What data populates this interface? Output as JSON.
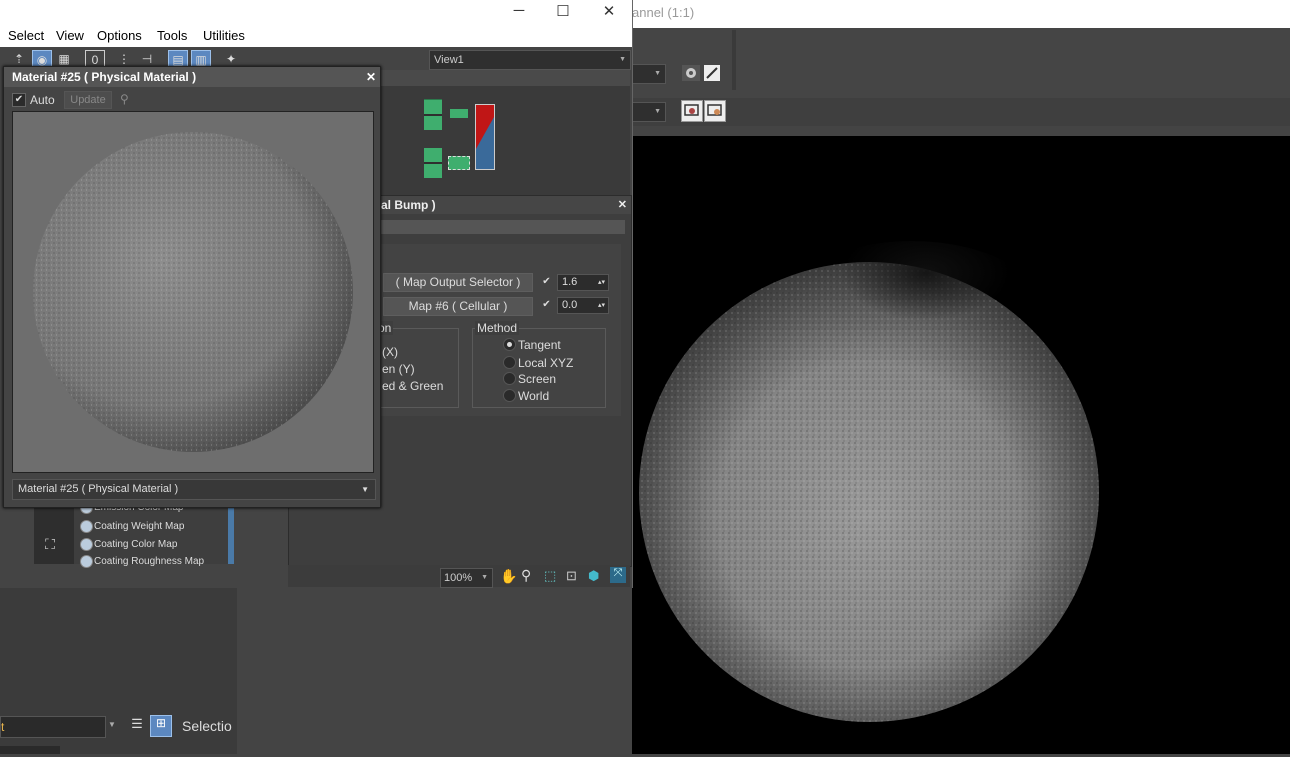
{
  "render_window": {
    "title": "annel (1:1)",
    "icons": [
      "render-setup-icon",
      "render-icon",
      "clone-rendered-icon",
      "save-image-icon"
    ]
  },
  "slate": {
    "menu": [
      "Select",
      "View",
      "Options",
      "Tools",
      "Utilities"
    ],
    "view_dropdown": "View1",
    "node_panel_title": "al Bump )",
    "params": {
      "row1_button": "( Map Output Selector )",
      "row1_value": "1.6",
      "row2_button": "Map #6  ( Cellular )",
      "row2_value": "0.0",
      "left_group_label": "on",
      "left_options": [
        "(X)",
        "en (Y)",
        "ed & Green"
      ],
      "method_label": "Method",
      "method_options": [
        "Tangent",
        "Local XYZ",
        "Screen",
        "World"
      ],
      "method_selected": "Tangent"
    },
    "zoom": "100%",
    "map_list": [
      "Emission Color Map",
      "Coating Weight Map",
      "Coating Color Map",
      "Coating Roughness Map"
    ]
  },
  "material_window": {
    "title": "Material #25  ( Physical Material )",
    "auto_label": "Auto",
    "update_label": "Update",
    "selector": "Material #25  ( Physical Material )"
  },
  "bottom_left": {
    "selection_label": "Selectio",
    "value": "t"
  },
  "colors": {
    "accent_blue": "#5c88c0",
    "node_green": "#3fae6e",
    "node_red": "#c01616"
  }
}
